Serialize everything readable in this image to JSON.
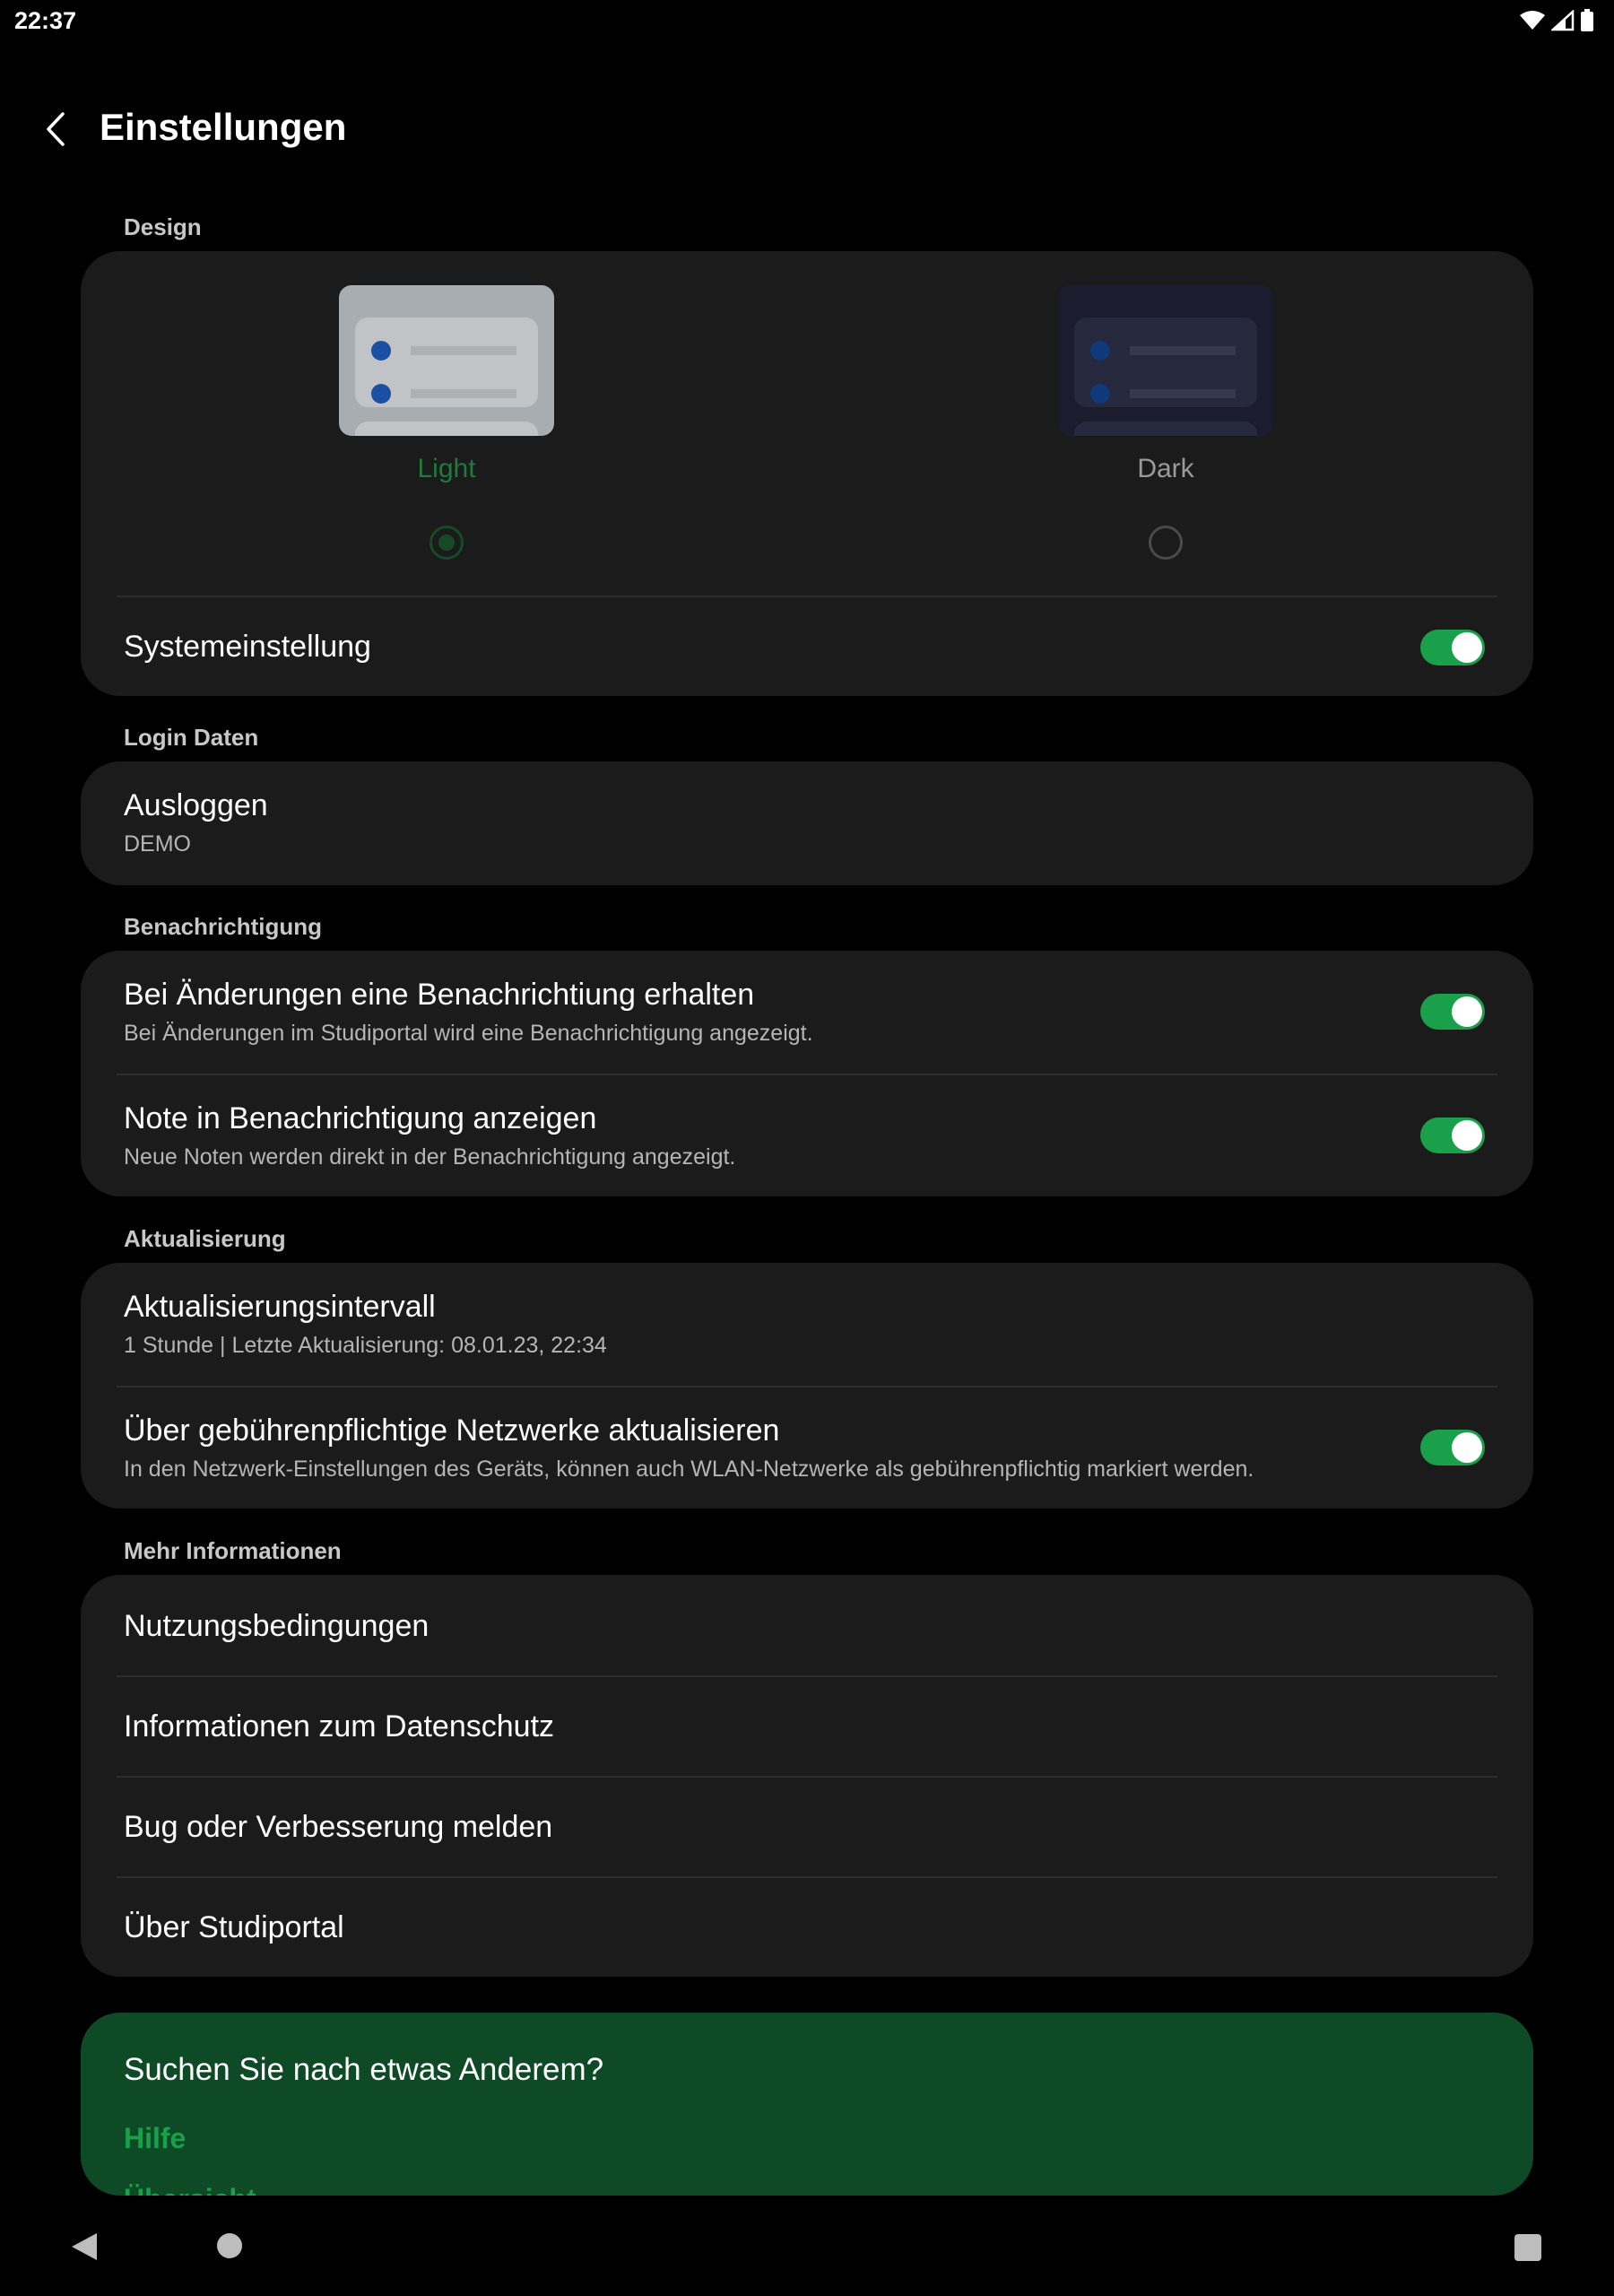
{
  "status_bar": {
    "time": "22:37"
  },
  "header": {
    "title": "Einstellungen"
  },
  "design": {
    "section_title": "Design",
    "options": [
      {
        "label": "Light",
        "selected": true
      },
      {
        "label": "Dark",
        "selected": false
      }
    ],
    "system_setting": {
      "label": "Systemeinstellung",
      "enabled": true
    }
  },
  "login": {
    "section_title": "Login Daten",
    "logout": {
      "title": "Ausloggen",
      "subtitle": "DEMO"
    }
  },
  "notifications": {
    "section_title": "Benachrichtigung",
    "items": [
      {
        "title": "Bei Änderungen eine Benachrichtiung erhalten",
        "subtitle": "Bei Änderungen im Studiportal wird eine Benachrichtigung angezeigt.",
        "enabled": true
      },
      {
        "title": "Note in Benachrichtigung anzeigen",
        "subtitle": "Neue Noten werden direkt in der Benachrichtigung angezeigt.",
        "enabled": true
      }
    ]
  },
  "update": {
    "section_title": "Aktualisierung",
    "interval": {
      "title": "Aktualisierungsintervall",
      "subtitle": "1 Stunde | Letzte Aktualisierung: 08.01.23, 22:34"
    },
    "metered": {
      "title": "Über gebührenpflichtige Netzwerke aktualisieren",
      "subtitle": "In den Netzwerk-Einstellungen des Geräts, können auch WLAN-Netzwerke als gebührenpflichtig markiert werden.",
      "enabled": true
    }
  },
  "more_info": {
    "section_title": "Mehr Informationen",
    "items": [
      "Nutzungsbedingungen",
      "Informationen zum Datenschutz",
      "Bug oder Verbesserung melden",
      "Über Studiportal"
    ]
  },
  "promo": {
    "title": "Suchen Sie nach etwas Anderem?",
    "links": [
      "Hilfe",
      "Übersicht"
    ]
  },
  "colors": {
    "accent": "#1aa04a",
    "background": "#000000",
    "card": "#1b1b1b",
    "promo_bg": "#0e4a26"
  }
}
